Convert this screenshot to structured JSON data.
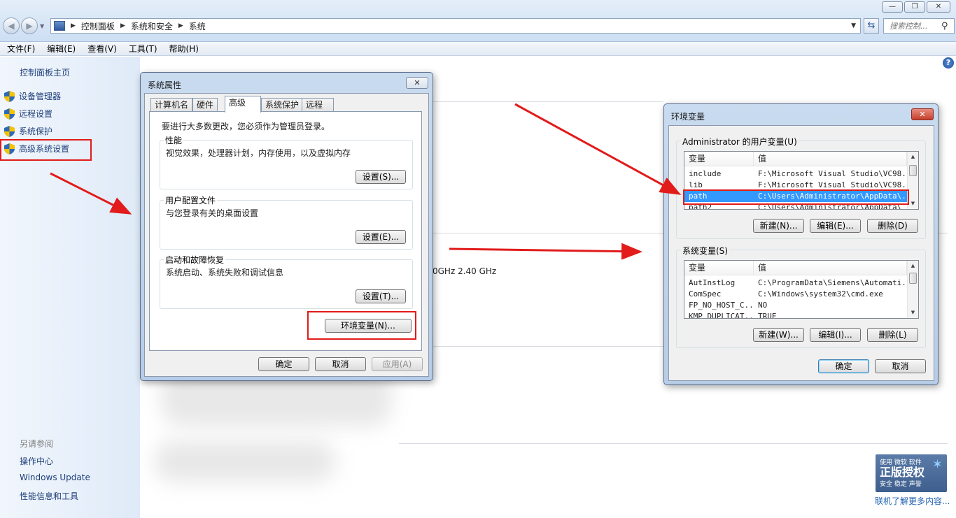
{
  "window": {
    "breadcrumb": [
      "控制面板",
      "系统和安全",
      "系统"
    ],
    "search_placeholder": "搜索控制...",
    "controls": [
      "—",
      "❐",
      "✕"
    ]
  },
  "menubar": [
    "文件(F)",
    "编辑(E)",
    "查看(V)",
    "工具(T)",
    "帮助(H)"
  ],
  "sidebar": {
    "home": "控制面板主页",
    "links": [
      "设备管理器",
      "远程设置",
      "系统保护",
      "高级系统设置"
    ],
    "see_also_header": "另请参阅",
    "see_also": [
      "操作中心",
      "Windows Update",
      "性能信息和工具"
    ]
  },
  "main": {
    "cpu_text": "0GHz   2.40 GHz",
    "genuine_badge": {
      "top": "使用 微软 软件",
      "big": "正版授权",
      "bottom": "安全 稳定 声誉"
    },
    "genuine_link": "联机了解更多内容..."
  },
  "sysprops": {
    "title": "系统属性",
    "tabs": [
      "计算机名",
      "硬件",
      "高级",
      "系统保护",
      "远程"
    ],
    "active_tab": "高级",
    "admin_note": "要进行大多数更改，您必须作为管理员登录。",
    "perf": {
      "label": "性能",
      "desc": "视觉效果，处理器计划，内存使用，以及虚拟内存",
      "button": "设置(S)..."
    },
    "profile": {
      "label": "用户配置文件",
      "desc": "与您登录有关的桌面设置",
      "button": "设置(E)..."
    },
    "startup": {
      "label": "启动和故障恢复",
      "desc": "系统启动、系统失败和调试信息",
      "button": "设置(T)..."
    },
    "env_button": "环境变量(N)...",
    "ok": "确定",
    "cancel": "取消",
    "apply": "应用(A)"
  },
  "envvars": {
    "title": "环境变量",
    "user_group": "Administrator 的用户变量(U)",
    "col_var": "变量",
    "col_val": "值",
    "user_rows": [
      {
        "name": "include",
        "value": "F:\\Microsoft Visual Studio\\VC98..."
      },
      {
        "name": "lib",
        "value": "F:\\Microsoft Visual Studio\\VC98..."
      },
      {
        "name": "path",
        "value": "C:\\Users\\Administrator\\AppData\\..."
      },
      {
        "name": "path2",
        "value": "C:\\Users\\Administrator\\AppData\\"
      }
    ],
    "selected_user_row": "path",
    "user_buttons": [
      "新建(N)...",
      "编辑(E)...",
      "删除(D)"
    ],
    "sys_group": "系统变量(S)",
    "sys_rows": [
      {
        "name": "AutInstLog",
        "value": "C:\\ProgramData\\Siemens\\Automati..."
      },
      {
        "name": "ComSpec",
        "value": "C:\\Windows\\system32\\cmd.exe"
      },
      {
        "name": "FP_NO_HOST_C...",
        "value": "NO"
      },
      {
        "name": "KMP_DUPLICAT...",
        "value": "TRUE"
      }
    ],
    "sys_buttons": [
      "新建(W)...",
      "编辑(I)...",
      "删除(L)"
    ],
    "ok": "确定",
    "cancel": "取消"
  },
  "colors": {
    "annotation": "#e21b1b",
    "link": "#1e3f7a",
    "selection": "#3399ff"
  }
}
